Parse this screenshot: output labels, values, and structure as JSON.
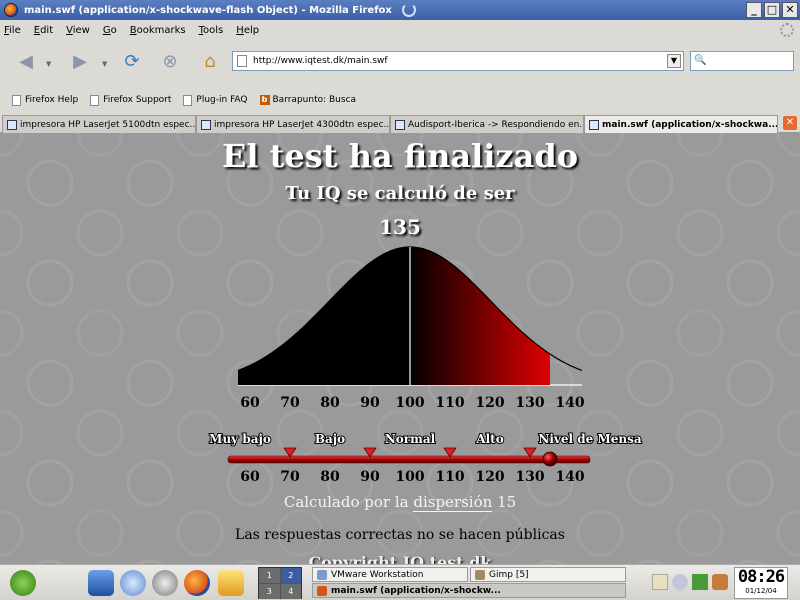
{
  "window": {
    "title": "main.swf (application/x-shockwave-flash Object) - Mozilla Firefox"
  },
  "menu": [
    "File",
    "Edit",
    "View",
    "Go",
    "Bookmarks",
    "Tools",
    "Help"
  ],
  "menu_mnemonics": [
    "F",
    "E",
    "V",
    "G",
    "B",
    "T",
    "H"
  ],
  "url": "http://www.iqtest.dk/main.swf",
  "bookmarks": [
    "Firefox Help",
    "Firefox Support",
    "Plug-in FAQ",
    "Barrapunto: Busca"
  ],
  "tabs": [
    "impresora HP LaserJet 5100dtn espec...",
    "impresora HP LaserJet 4300dtn espec...",
    "Audisport-Iberica -> Respondiendo en...",
    "main.swf (application/x-shockwa..."
  ],
  "content": {
    "heading": "El test ha finalizado",
    "subheading": "Tu IQ se calculó de ser",
    "score": "135",
    "dispersion_prefix": "Calculado por la ",
    "dispersion_link": "dispersión",
    "dispersion_value": "15",
    "note": "Las respuestas correctas no se hacen públicas",
    "copyright": "Copyright IQ test.dk"
  },
  "chart_data": {
    "type": "area",
    "description_marker": 100,
    "score": 135,
    "mean": 100,
    "sd": 15,
    "x_ticks": [
      60,
      70,
      80,
      90,
      100,
      110,
      120,
      130,
      140
    ],
    "xlim": [
      60,
      140
    ],
    "colors": {
      "low": "#000000",
      "high": "#e00000",
      "mean_line": "#ffffff"
    }
  },
  "scale": {
    "labels": [
      "Muy bajo",
      "Bajo",
      "Normal",
      "Alto",
      "Nivel de Mensa"
    ],
    "ticks": [
      60,
      70,
      80,
      90,
      100,
      110,
      120,
      130,
      140
    ],
    "markers": [
      70,
      90,
      110,
      130
    ],
    "knob_value": 135,
    "track_color": "#b80000"
  },
  "taskbar": {
    "pager": [
      "1",
      "2",
      "3",
      "4"
    ],
    "tasks": [
      "VMware Workstation",
      "Gimp [5]",
      "main.swf (application/x-shockw..."
    ],
    "clock_time": "08:26",
    "clock_date": "01/12/04"
  }
}
